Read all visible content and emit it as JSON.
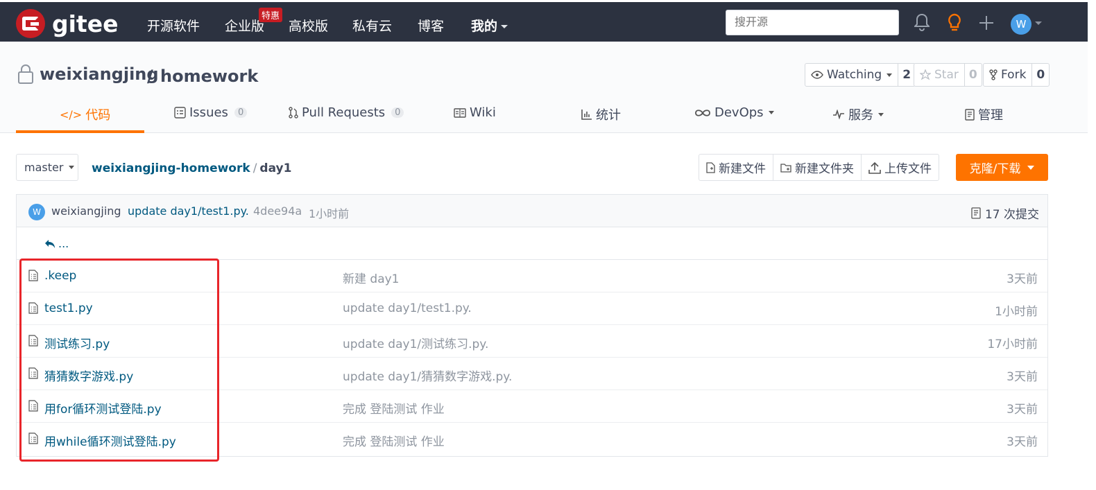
{
  "topbar": {
    "logo_text": "gitee",
    "nav": [
      {
        "label": "开源软件"
      },
      {
        "label": "企业版",
        "badge": "特惠"
      },
      {
        "label": "高校版"
      },
      {
        "label": "私有云"
      },
      {
        "label": "博客"
      },
      {
        "label": "我的"
      }
    ],
    "search_placeholder": "搜开源",
    "avatar_initial": "W",
    "icons": [
      "bell-icon",
      "lightbulb-icon",
      "plus-icon"
    ]
  },
  "repo": {
    "owner": "weixiangjing",
    "slash": "/",
    "name": "homework",
    "watch_label": "Watching",
    "watch_count": "2",
    "star_label": "Star",
    "star_count": "0",
    "fork_label": "Fork",
    "fork_count": "0"
  },
  "tabs": [
    {
      "label": "代码",
      "icon": "code-icon",
      "active": true
    },
    {
      "label": "Issues",
      "count": "0",
      "icon": "issues-icon"
    },
    {
      "label": "Pull Requests",
      "count": "0",
      "icon": "pull-request-icon"
    },
    {
      "label": "Wiki",
      "icon": "wiki-icon"
    },
    {
      "label": "统计",
      "icon": "stats-icon"
    },
    {
      "label": "DevOps",
      "icon": "devops-icon"
    },
    {
      "label": "服务",
      "icon": "service-icon"
    },
    {
      "label": "管理",
      "icon": "manage-icon"
    }
  ],
  "toolbar": {
    "branch": "master",
    "crumb_repo": "weixiangjing-homework",
    "crumb_sep": "/",
    "crumb_dir": "day1",
    "new_file": "新建文件",
    "new_folder": "新建文件夹",
    "upload": "上传文件",
    "clone": "克隆/下载"
  },
  "commit": {
    "avatar_initial": "W",
    "author": "weixiangjing",
    "message": "update day1/test1.py.",
    "sha": "4dee94a",
    "time": "1小时前",
    "count_label": "17 次提交"
  },
  "files": {
    "up_label": "...",
    "rows": [
      {
        "name": ".keep",
        "message": "新建 day1",
        "time": "3天前"
      },
      {
        "name": "test1.py",
        "message": "update day1/test1.py.",
        "time": "1小时前"
      },
      {
        "name": "测试练习.py",
        "message": "update day1/测试练习.py.",
        "time": "17小时前"
      },
      {
        "name": "猜猜数字游戏.py",
        "message": "update day1/猜猜数字游戏.py.",
        "time": "3天前"
      },
      {
        "name": "用for循环测试登陆.py",
        "message": "完成 登陆测试 作业",
        "time": "3天前"
      },
      {
        "name": "用while循环测试登陆.py",
        "message": "完成 登陆测试 作业",
        "time": "3天前"
      }
    ]
  },
  "colors": {
    "accent": "#fe7300",
    "link": "#005980",
    "topbar_bg": "#2c3240",
    "highlight": "#e8252a"
  }
}
